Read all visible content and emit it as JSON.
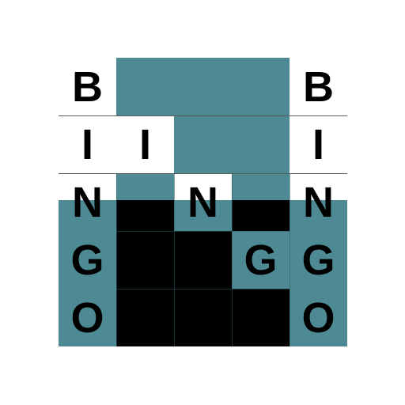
{
  "board": {
    "cells": [
      [
        "B",
        "",
        "",
        "",
        "B"
      ],
      [
        "I",
        "I",
        "",
        "",
        "I"
      ],
      [
        "N",
        "",
        "N",
        "",
        "N"
      ],
      [
        "G",
        "",
        "",
        "G",
        "G"
      ],
      [
        "O",
        "",
        "",
        "",
        "O"
      ]
    ]
  },
  "colors": {
    "teal": "#4e8a93",
    "black": "#000000",
    "white": "#ffffff"
  }
}
